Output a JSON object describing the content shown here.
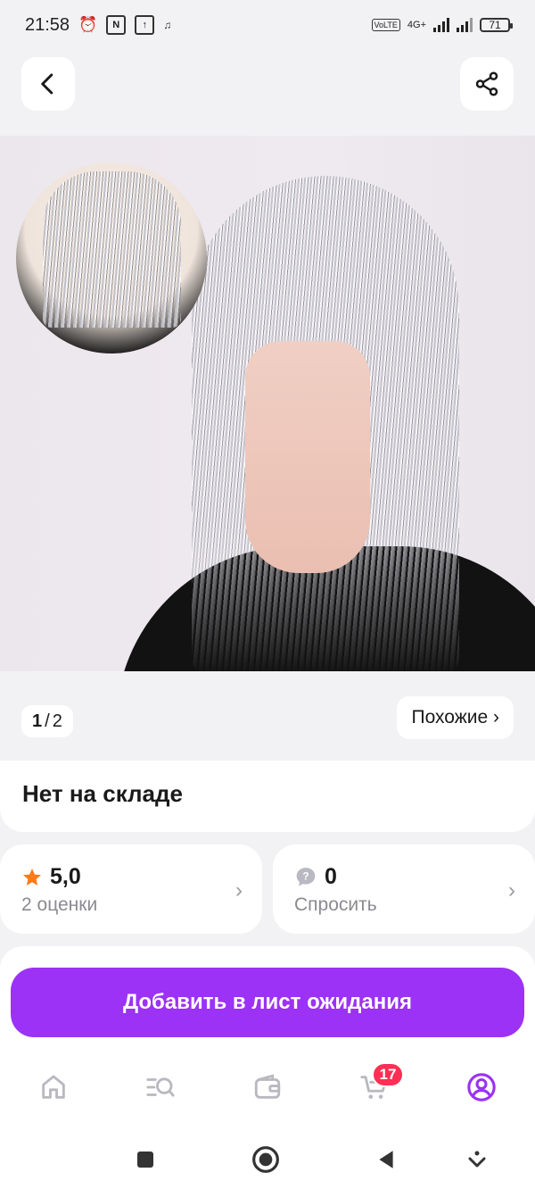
{
  "status_bar": {
    "time": "21:58",
    "network": "4G+",
    "volte": "VoLTE",
    "battery": "71"
  },
  "header": {
    "back_icon": "chevron-left-icon",
    "share_icon": "share-icon"
  },
  "gallery": {
    "current": "1",
    "separator": "/",
    "total": "2",
    "similar_label": "Похожие ›"
  },
  "product": {
    "stock_status": "Нет на складе",
    "rating": {
      "value": "5,0",
      "label": "2 оценки",
      "icon": "star-icon",
      "color": "#ff7a1a"
    },
    "questions": {
      "value": "0",
      "label": "Спросить",
      "icon": "question-bubble-icon"
    }
  },
  "actions": {
    "waitlist_label": "Добавить в лист ожидания",
    "accent": "#9b32f5"
  },
  "bottom_nav": {
    "items": [
      {
        "icon": "home-icon"
      },
      {
        "icon": "catalog-search-icon"
      },
      {
        "icon": "wallet-icon"
      },
      {
        "icon": "cart-icon",
        "badge": "17"
      },
      {
        "icon": "profile-icon",
        "active": true
      }
    ],
    "active_color": "#9b32f5",
    "badge_color": "#ff2f54"
  }
}
